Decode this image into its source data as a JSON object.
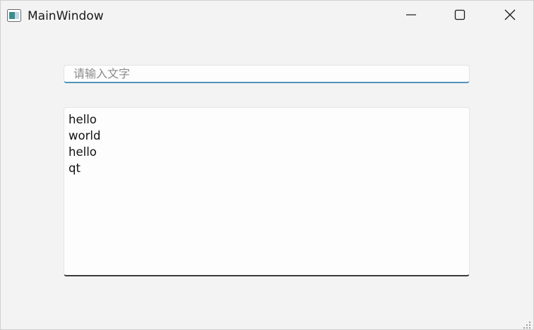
{
  "window": {
    "title": "MainWindow",
    "app_icon": "qt-window-icon",
    "controls": {
      "minimize_icon": "minimize-icon",
      "maximize_icon": "maximize-icon",
      "close_icon": "close-icon"
    }
  },
  "input": {
    "value": "",
    "placeholder": "请输入文字"
  },
  "text_edit": {
    "lines": [
      "hello",
      "world",
      "hello",
      "qt"
    ]
  },
  "colors": {
    "background": "#f3f3f3",
    "input_focus_underline": "#4f95b7",
    "text_edit_underline": "#3a3a3a"
  }
}
